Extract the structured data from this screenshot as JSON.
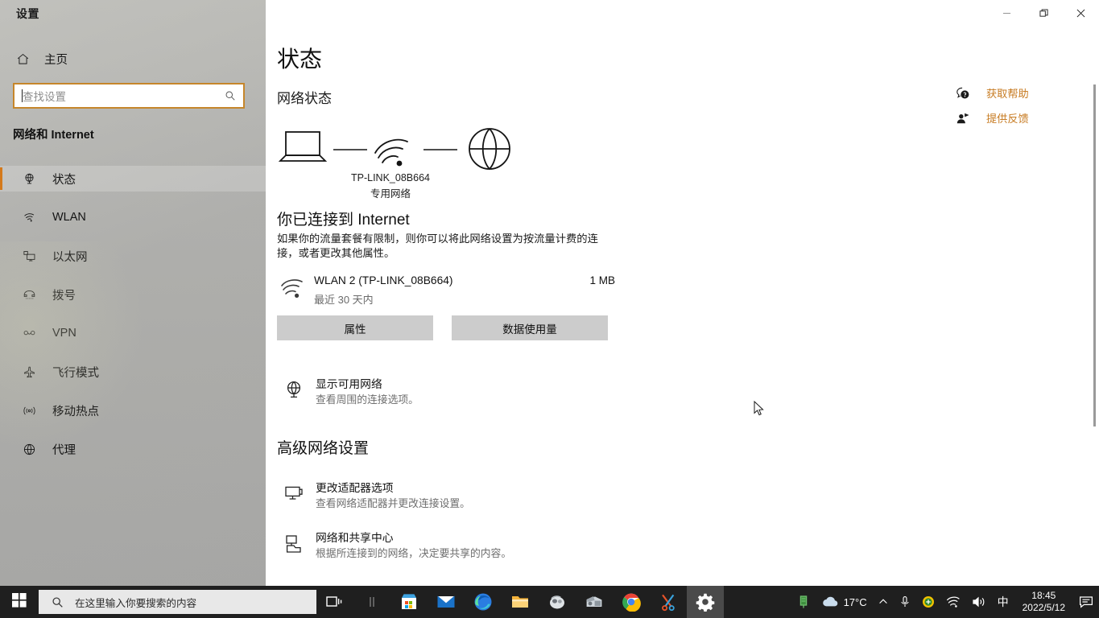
{
  "sidebar": {
    "app_title": "设置",
    "home_label": "主页",
    "search_placeholder": "查找设置",
    "category_title": "网络和 Internet",
    "items": [
      {
        "label": "状态",
        "icon": "status-globe-icon",
        "selected": true
      },
      {
        "label": "WLAN",
        "icon": "wifi-icon",
        "selected": false
      },
      {
        "label": "以太网",
        "icon": "ethernet-icon",
        "selected": false
      },
      {
        "label": "拨号",
        "icon": "dialup-phone-icon",
        "selected": false
      },
      {
        "label": "VPN",
        "icon": "vpn-icon",
        "selected": false
      },
      {
        "label": "飞行模式",
        "icon": "airplane-icon",
        "selected": false
      },
      {
        "label": "移动热点",
        "icon": "mobile-hotspot-icon",
        "selected": false
      },
      {
        "label": "代理",
        "icon": "proxy-globe-icon",
        "selected": false
      }
    ]
  },
  "window": {
    "minimize_icon": "minimize-icon",
    "restore_icon": "restore-icon",
    "close_icon": "close-icon"
  },
  "main": {
    "page_title": "状态",
    "network_status_heading": "网络状态",
    "diagram": {
      "network_name": "TP-LINK_08B664",
      "network_type": "专用网络",
      "device_icon": "laptop-icon",
      "signal_icon": "wifi-icon",
      "internet_icon": "globe-icon"
    },
    "connected_heading": "你已连接到 Internet",
    "connected_desc": "如果你的流量套餐有限制，则你可以将此网络设置为按流量计费的连接，或者更改其他属性。",
    "adapter": {
      "name": "WLAN 2 (TP-LINK_08B664)",
      "subtitle": "最近 30 天内",
      "data_used": "1 MB",
      "icon": "wifi-icon"
    },
    "buttons": {
      "properties": "属性",
      "data_usage": "数据使用量"
    },
    "show_networks": {
      "title": "显示可用网络",
      "subtitle": "查看周围的连接选项。",
      "icon": "globe-network-icon"
    },
    "advanced_heading": "高级网络设置",
    "advanced_items": [
      {
        "title": "更改适配器选项",
        "subtitle": "查看网络适配器并更改连接设置。",
        "icon": "adapter-monitor-icon"
      },
      {
        "title": "网络和共享中心",
        "subtitle": "根据所连接到的网络，决定要共享的内容。",
        "icon": "sharing-center-icon"
      }
    ]
  },
  "help": {
    "items": [
      {
        "label": "获取帮助",
        "icon": "question-bubble-icon"
      },
      {
        "label": "提供反馈",
        "icon": "feedback-person-icon"
      }
    ],
    "link_color": "#c77b22"
  },
  "taskbar": {
    "start_icon": "windows-start-icon",
    "search_placeholder": "在这里输入你要搜索的内容",
    "search_icon": "search-icon",
    "apps": [
      {
        "name": "task-view-icon",
        "active": false
      },
      {
        "name": "separator-icon",
        "active": false
      },
      {
        "name": "microsoft-store-icon",
        "active": false
      },
      {
        "name": "mail-icon",
        "active": false
      },
      {
        "name": "microsoft-edge-icon",
        "active": false
      },
      {
        "name": "file-explorer-icon",
        "active": false
      },
      {
        "name": "app-icon-1",
        "active": false
      },
      {
        "name": "app-icon-2",
        "active": false
      },
      {
        "name": "google-chrome-icon",
        "active": false
      },
      {
        "name": "snipping-tool-icon",
        "active": false
      },
      {
        "name": "settings-gear-icon",
        "active": true
      }
    ],
    "tray": {
      "usb_icon": "usb-icon",
      "weather_icon": "cloud-icon",
      "temperature": "17°C",
      "chevron_icon": "chevron-up-icon",
      "mic_icon": "microphone-icon",
      "security_icon": "security-shield-icon",
      "wifi_icon": "wifi-icon",
      "volume_icon": "volume-icon",
      "ime_label": "中",
      "time": "18:45",
      "date": "2022/5/12",
      "notification_icon": "notification-icon"
    }
  },
  "accent_colors": {
    "selection_bar": "#d4791b",
    "search_border": "#c6862b",
    "link": "#c77b22",
    "button_bg": "#cccccc"
  }
}
